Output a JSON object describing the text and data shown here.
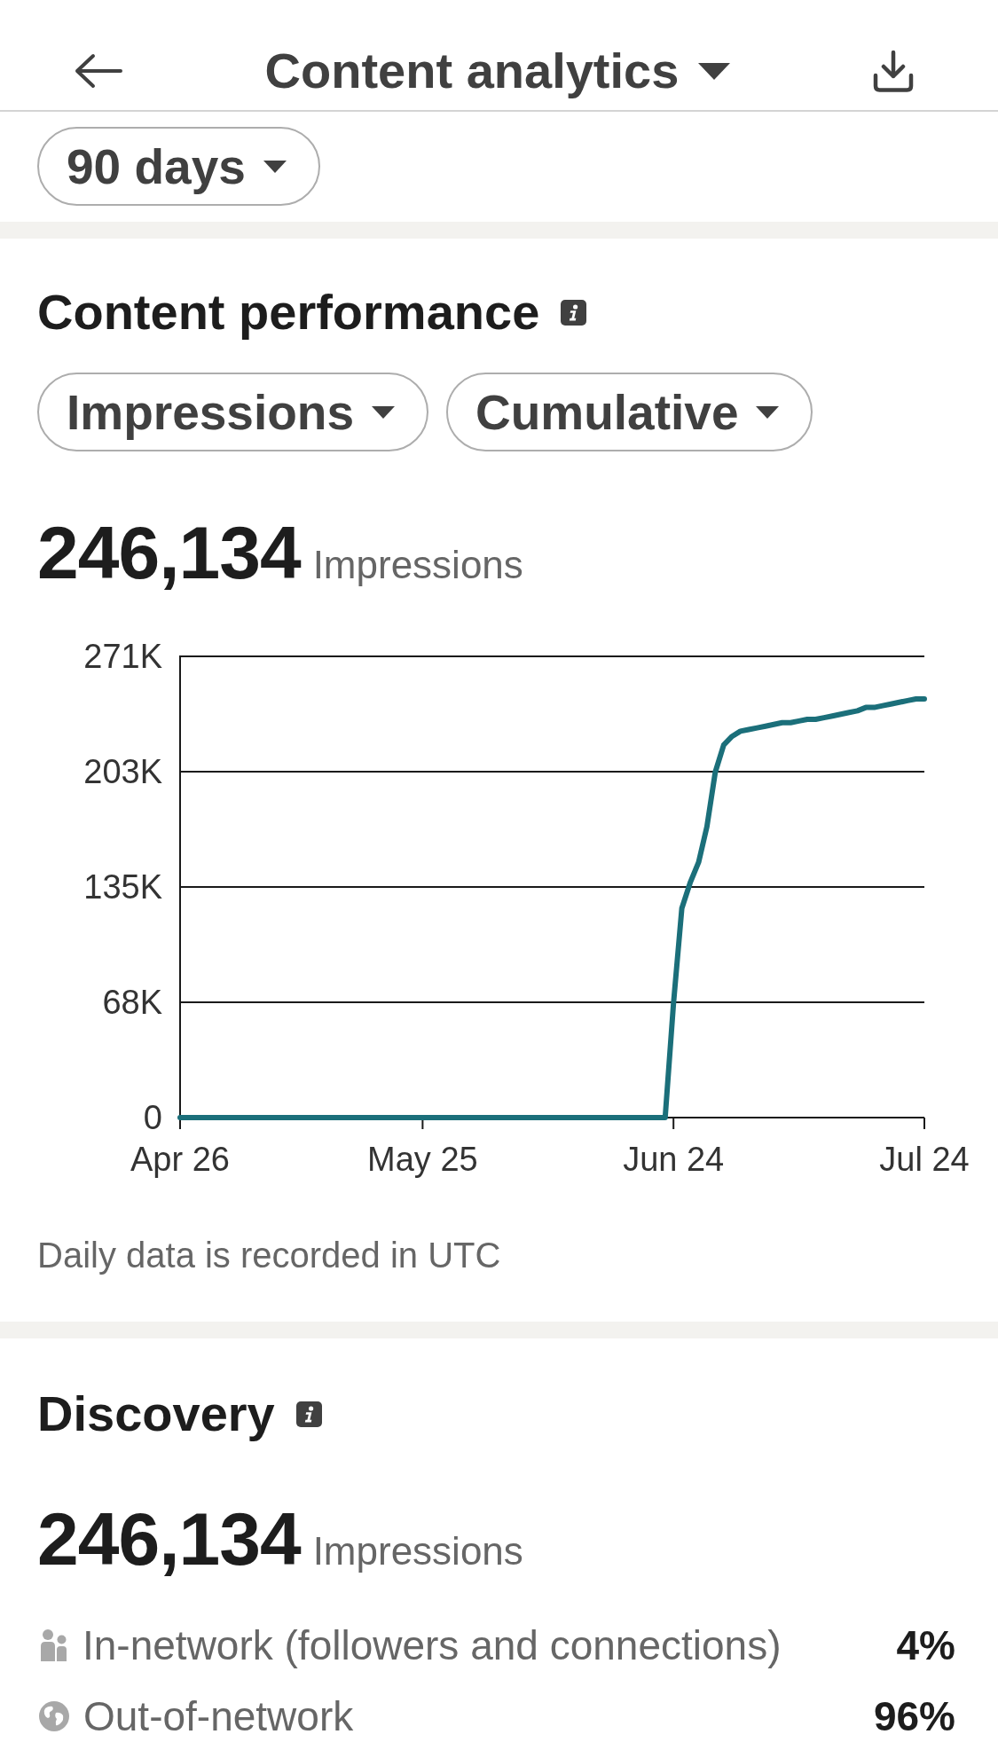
{
  "header": {
    "title": "Content analytics"
  },
  "filters": {
    "period": "90 days"
  },
  "content_performance": {
    "title": "Content performance",
    "metric_filter": "Impressions",
    "mode_filter": "Cumulative",
    "total": "246,134",
    "total_label": "Impressions",
    "chart_data": {
      "type": "line",
      "categories": [
        "Apr 26",
        null,
        null,
        null,
        null,
        null,
        null,
        null,
        null,
        null,
        null,
        null,
        null,
        null,
        null,
        null,
        null,
        null,
        null,
        null,
        null,
        null,
        null,
        null,
        null,
        null,
        null,
        null,
        null,
        "May 25",
        null,
        null,
        null,
        null,
        null,
        null,
        null,
        null,
        null,
        null,
        null,
        null,
        null,
        null,
        null,
        null,
        null,
        null,
        null,
        null,
        null,
        null,
        null,
        null,
        null,
        null,
        null,
        null,
        null,
        "Jun 24",
        null,
        null,
        null,
        null,
        null,
        null,
        null,
        null,
        null,
        null,
        null,
        null,
        null,
        null,
        null,
        null,
        null,
        null,
        null,
        null,
        null,
        null,
        null,
        null,
        null,
        null,
        null,
        null,
        null,
        "Jul 24"
      ],
      "series": [
        {
          "color": "#1b6f7a",
          "values": [
            0,
            0,
            0,
            0,
            0,
            0,
            0,
            0,
            0,
            0,
            0,
            0,
            0,
            0,
            0,
            0,
            0,
            0,
            0,
            0,
            0,
            0,
            0,
            0,
            0,
            0,
            0,
            0,
            0,
            0,
            0,
            0,
            0,
            0,
            0,
            0,
            0,
            0,
            0,
            0,
            0,
            0,
            0,
            0,
            0,
            0,
            0,
            0,
            0,
            0,
            0,
            0,
            0,
            0,
            0,
            0,
            0,
            0,
            0,
            67000,
            123000,
            138000,
            150000,
            171000,
            203000,
            219000,
            224000,
            227000,
            228000,
            229000,
            230000,
            231000,
            232000,
            232000,
            233000,
            234000,
            234000,
            235000,
            236000,
            237000,
            238000,
            239000,
            241000,
            241000,
            242000,
            243000,
            244000,
            245000,
            246000,
            246000
          ]
        }
      ],
      "ylim": [
        0,
        271000
      ],
      "yticks": [
        {
          "value": 0,
          "label": "0"
        },
        {
          "value": 67750,
          "label": "68K"
        },
        {
          "value": 135500,
          "label": "135K"
        },
        {
          "value": 203250,
          "label": "203K"
        },
        {
          "value": 271000,
          "label": "271K"
        }
      ],
      "grid": true
    },
    "note": "Daily data is recorded in UTC"
  },
  "discovery": {
    "title": "Discovery",
    "total": "246,134",
    "total_label": "Impressions",
    "rows": [
      {
        "kind": "in_network",
        "label": "In-network (followers and connections)",
        "share": "4%"
      },
      {
        "kind": "out_of_network",
        "label": "Out-of-network",
        "share": "96%"
      }
    ]
  }
}
